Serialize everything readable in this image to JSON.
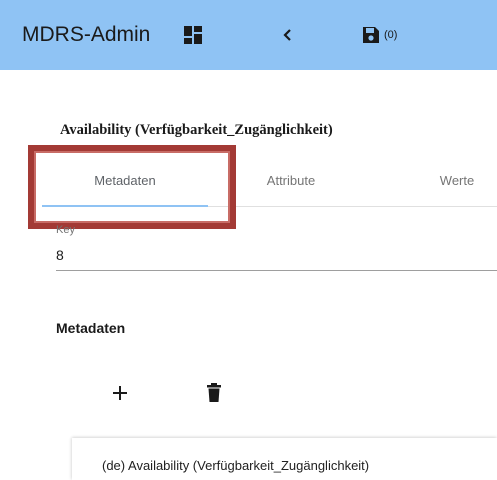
{
  "header": {
    "app_title": "MDRS-Admin",
    "dashboard_icon": "dashboard-icon",
    "back_icon": "chevron-left-icon",
    "save_icon": "save-icon",
    "save_count": "(0)",
    "background_color": "#8fc3f4"
  },
  "page": {
    "title": "Availability (Verfügbarkeit_Zugänglichkeit)"
  },
  "tabs": [
    {
      "label": "Metadaten",
      "active": true
    },
    {
      "label": "Attribute",
      "active": false
    },
    {
      "label": "Werte",
      "active": false
    }
  ],
  "key_field": {
    "label": "Key",
    "value": "8"
  },
  "metadaten_section": {
    "title": "Metadaten",
    "add_icon": "plus-icon",
    "delete_icon": "trash-icon",
    "items": [
      {
        "text": "(de) Availability (Verfügbarkeit_Zugänglichkeit)"
      }
    ]
  },
  "highlight_color": "#a33a35"
}
